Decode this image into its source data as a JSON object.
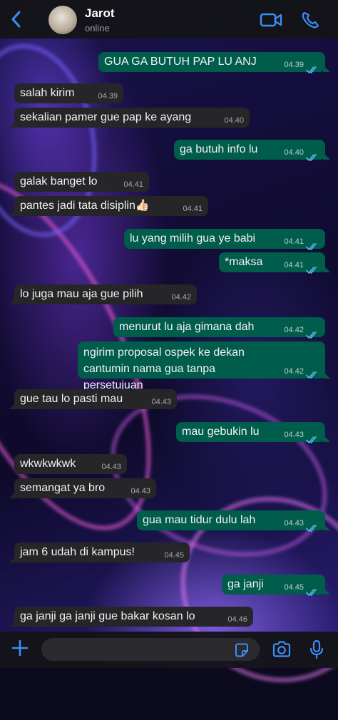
{
  "header": {
    "contact_name": "Jarot",
    "status": "online"
  },
  "colors": {
    "accent": "#3d8ef7",
    "incoming_bubble": "#262629",
    "outgoing_bubble": "#005c4b",
    "read_ticks": "#53bdeb"
  },
  "icons": [
    "back-chevron-icon",
    "video-call-icon",
    "phone-icon",
    "double-check-icon",
    "plus-icon",
    "sticker-icon",
    "camera-icon",
    "microphone-icon"
  ],
  "messages": [
    {
      "dir": "out",
      "text": "GUA GA BUTUH PAP LU ANJ",
      "time": "04.39"
    },
    {
      "dir": "in",
      "text": "salah kirim",
      "time": "04.39"
    },
    {
      "dir": "in",
      "text": "sekalian pamer gue pap ke ayang",
      "time": "04.40"
    },
    {
      "dir": "out",
      "text": "ga butuh info lu",
      "time": "04.40"
    },
    {
      "dir": "in",
      "text": "galak banget lo",
      "time": "04.41"
    },
    {
      "dir": "in",
      "text": "pantes jadi tata disiplin👍🏻",
      "time": "04.41"
    },
    {
      "dir": "out",
      "text": "lu yang milih gua ye babi",
      "time": "04.41"
    },
    {
      "dir": "out",
      "text": "*maksa",
      "time": "04.41"
    },
    {
      "dir": "in",
      "text": "lo juga mau aja gue pilih",
      "time": "04.42"
    },
    {
      "dir": "out",
      "text": "menurut lu aja gimana dah",
      "time": "04.42"
    },
    {
      "dir": "out",
      "text": "ngirim proposal ospek ke dekan cantumin nama gua tanpa persetujuan",
      "time": "04.42"
    },
    {
      "dir": "in",
      "text": "gue tau lo pasti mau",
      "time": "04.43"
    },
    {
      "dir": "out",
      "text": "mau gebukin lu",
      "time": "04.43"
    },
    {
      "dir": "in",
      "text": "wkwkwkwk",
      "time": "04.43"
    },
    {
      "dir": "in",
      "text": "semangat ya bro",
      "time": "04.43"
    },
    {
      "dir": "out",
      "text": "gua mau tidur dulu lah",
      "time": "04.43"
    },
    {
      "dir": "in",
      "text": "jam 6 udah di kampus!",
      "time": "04.45"
    },
    {
      "dir": "out",
      "text": "ga janji",
      "time": "04.45"
    },
    {
      "dir": "in",
      "text": "ga janji ga janji gue bakar kosan lo",
      "time": "04.46"
    }
  ],
  "composer": {
    "value": ""
  }
}
